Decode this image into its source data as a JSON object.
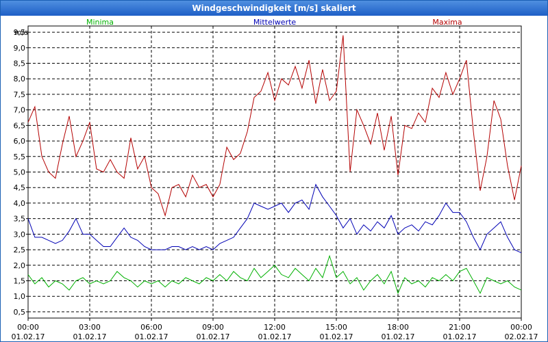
{
  "window": {
    "title": "Windgeschwindigkeit [m/s] skaliert"
  },
  "chart_data": {
    "type": "line",
    "ylabel": "m/s",
    "ylim": [
      0.3,
      9.7
    ],
    "yticks": [
      0.5,
      1.0,
      1.5,
      2.0,
      2.5,
      3.0,
      3.5,
      4.0,
      4.5,
      5.0,
      5.5,
      6.0,
      6.5,
      7.0,
      7.5,
      8.0,
      8.5,
      9.0,
      9.5
    ],
    "ytick_labels": [
      "0,5",
      "1,0",
      "1,5",
      "2,0",
      "2,5",
      "3,0",
      "3,5",
      "4,0",
      "4,5",
      "5,0",
      "5,5",
      "6,0",
      "6,5",
      "7,0",
      "7,5",
      "8,0",
      "8,5",
      "9,0",
      "9,5"
    ],
    "xlim": [
      0,
      24
    ],
    "xticks": [
      0,
      3,
      6,
      9,
      12,
      15,
      18,
      21,
      24
    ],
    "xtick_labels": [
      {
        "time": "00:00",
        "date": "01.02.17"
      },
      {
        "time": "03:00",
        "date": "01.02.17"
      },
      {
        "time": "06:00",
        "date": "01.02.17"
      },
      {
        "time": "09:00",
        "date": "01.02.17"
      },
      {
        "time": "12:00",
        "date": "01.02.17"
      },
      {
        "time": "15:00",
        "date": "01.02.17"
      },
      {
        "time": "18:00",
        "date": "01.02.17"
      },
      {
        "time": "21:00",
        "date": "01.02.17"
      },
      {
        "time": "00:00",
        "date": "02.02.17"
      }
    ],
    "grid": true,
    "series": [
      {
        "name": "Minima",
        "color": "#00b000",
        "x": [
          0,
          0.33,
          0.67,
          1,
          1.33,
          1.67,
          2,
          2.33,
          2.67,
          3,
          3.33,
          3.67,
          4,
          4.33,
          4.67,
          5,
          5.33,
          5.67,
          6,
          6.33,
          6.67,
          7,
          7.33,
          7.67,
          8,
          8.33,
          8.67,
          9,
          9.33,
          9.67,
          10,
          10.33,
          10.67,
          11,
          11.33,
          11.67,
          12,
          12.33,
          12.67,
          13,
          13.33,
          13.67,
          14,
          14.33,
          14.67,
          15,
          15.33,
          15.67,
          16,
          16.33,
          16.67,
          17,
          17.33,
          17.67,
          18,
          18.33,
          18.67,
          19,
          19.33,
          19.67,
          20,
          20.33,
          20.67,
          21,
          21.33,
          21.67,
          22,
          22.33,
          22.67,
          23,
          23.33,
          23.67,
          24
        ],
        "y": [
          1.7,
          1.4,
          1.6,
          1.3,
          1.5,
          1.4,
          1.2,
          1.5,
          1.6,
          1.4,
          1.5,
          1.4,
          1.5,
          1.8,
          1.6,
          1.5,
          1.3,
          1.5,
          1.4,
          1.5,
          1.3,
          1.5,
          1.4,
          1.6,
          1.5,
          1.4,
          1.6,
          1.5,
          1.7,
          1.5,
          1.8,
          1.6,
          1.5,
          1.9,
          1.6,
          1.8,
          2.0,
          1.7,
          1.6,
          1.9,
          1.7,
          1.5,
          1.9,
          1.6,
          2.3,
          1.6,
          1.8,
          1.4,
          1.6,
          1.2,
          1.5,
          1.7,
          1.4,
          1.8,
          1.1,
          1.6,
          1.4,
          1.5,
          1.3,
          1.6,
          1.5,
          1.7,
          1.5,
          1.8,
          1.9,
          1.5,
          1.1,
          1.6,
          1.5,
          1.4,
          1.5,
          1.3,
          1.2
        ]
      },
      {
        "name": "Mittelwerte",
        "color": "#0000b4",
        "x": [
          0,
          0.33,
          0.67,
          1,
          1.33,
          1.67,
          2,
          2.33,
          2.67,
          3,
          3.33,
          3.67,
          4,
          4.33,
          4.67,
          5,
          5.33,
          5.67,
          6,
          6.33,
          6.67,
          7,
          7.33,
          7.67,
          8,
          8.33,
          8.67,
          9,
          9.33,
          9.67,
          10,
          10.33,
          10.67,
          11,
          11.33,
          11.67,
          12,
          12.33,
          12.67,
          13,
          13.33,
          13.67,
          14,
          14.33,
          14.67,
          15,
          15.33,
          15.67,
          16,
          16.33,
          16.67,
          17,
          17.33,
          17.67,
          18,
          18.33,
          18.67,
          19,
          19.33,
          19.67,
          20,
          20.33,
          20.67,
          21,
          21.33,
          21.67,
          22,
          22.33,
          22.67,
          23,
          23.33,
          23.67,
          24
        ],
        "y": [
          3.5,
          2.9,
          2.9,
          2.8,
          2.7,
          2.8,
          3.1,
          3.5,
          3.0,
          3.0,
          2.8,
          2.6,
          2.6,
          2.9,
          3.2,
          2.9,
          2.8,
          2.6,
          2.5,
          2.5,
          2.5,
          2.6,
          2.6,
          2.5,
          2.6,
          2.5,
          2.6,
          2.5,
          2.7,
          2.8,
          2.9,
          3.2,
          3.5,
          4.0,
          3.9,
          3.8,
          3.9,
          4.0,
          3.7,
          4.0,
          4.1,
          3.8,
          4.6,
          4.2,
          3.9,
          3.6,
          3.2,
          3.5,
          3.0,
          3.3,
          3.1,
          3.4,
          3.2,
          3.6,
          3.0,
          3.2,
          3.3,
          3.1,
          3.4,
          3.3,
          3.6,
          4.0,
          3.7,
          3.7,
          3.4,
          2.9,
          2.5,
          3.0,
          3.2,
          3.4,
          2.9,
          2.5,
          2.4
        ]
      },
      {
        "name": "Maxima",
        "color": "#b40000",
        "x": [
          0,
          0.33,
          0.67,
          1,
          1.33,
          1.67,
          2,
          2.33,
          2.67,
          3,
          3.33,
          3.67,
          4,
          4.33,
          4.67,
          5,
          5.33,
          5.67,
          6,
          6.33,
          6.67,
          7,
          7.33,
          7.67,
          8,
          8.33,
          8.67,
          9,
          9.33,
          9.67,
          10,
          10.33,
          10.67,
          11,
          11.33,
          11.67,
          12,
          12.33,
          12.67,
          13,
          13.33,
          13.67,
          14,
          14.33,
          14.67,
          15,
          15.33,
          15.67,
          16,
          16.33,
          16.67,
          17,
          17.33,
          17.67,
          18,
          18.33,
          18.67,
          19,
          19.33,
          19.67,
          20,
          20.33,
          20.67,
          21,
          21.33,
          21.67,
          22,
          22.33,
          22.67,
          23,
          23.33,
          23.67,
          24
        ],
        "y": [
          6.6,
          7.1,
          5.5,
          5.0,
          4.8,
          5.9,
          6.8,
          5.5,
          6.0,
          6.6,
          5.1,
          5.0,
          5.4,
          5.0,
          4.8,
          6.1,
          5.1,
          5.5,
          4.5,
          4.3,
          3.6,
          4.5,
          4.6,
          4.2,
          4.9,
          4.5,
          4.6,
          4.2,
          4.6,
          5.8,
          5.4,
          5.6,
          6.3,
          7.4,
          7.6,
          8.2,
          7.3,
          8.0,
          7.8,
          8.4,
          7.7,
          8.6,
          7.2,
          8.3,
          7.3,
          7.6,
          9.4,
          5.0,
          7.0,
          6.5,
          5.9,
          6.9,
          5.7,
          6.8,
          4.9,
          6.5,
          6.4,
          6.9,
          6.6,
          7.7,
          7.4,
          8.2,
          7.5,
          8.0,
          8.6,
          6.3,
          4.4,
          5.5,
          7.3,
          6.7,
          5.2,
          4.1,
          5.2
        ]
      }
    ]
  }
}
